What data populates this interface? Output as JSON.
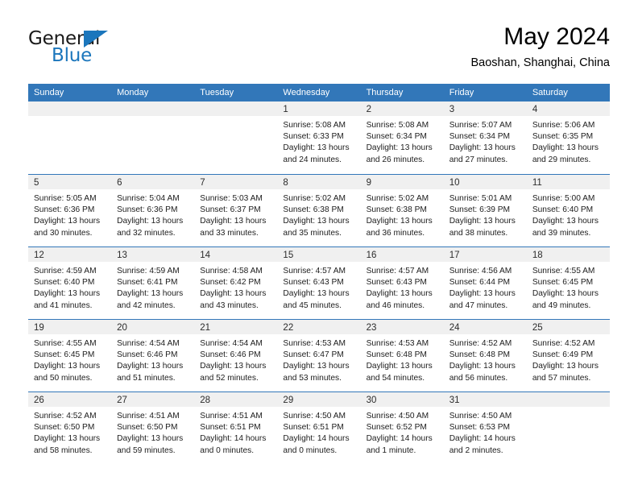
{
  "brand": {
    "name_top": "General",
    "name_bottom": "Blue",
    "color_black": "#1a1a1a",
    "color_blue": "#1b76bc"
  },
  "header": {
    "title": "May 2024",
    "subtitle": "Baoshan, Shanghai, China"
  },
  "theme": {
    "header_bar": "#3277b9",
    "date_band": "#f0f0f0",
    "text": "#1c1c1c"
  },
  "calendar": {
    "day_headers": [
      "Sunday",
      "Monday",
      "Tuesday",
      "Wednesday",
      "Thursday",
      "Friday",
      "Saturday"
    ],
    "weeks": [
      [
        {
          "date": "",
          "lines": []
        },
        {
          "date": "",
          "lines": []
        },
        {
          "date": "",
          "lines": []
        },
        {
          "date": "1",
          "lines": [
            "Sunrise: 5:08 AM",
            "Sunset: 6:33 PM",
            "Daylight: 13 hours",
            "and 24 minutes."
          ]
        },
        {
          "date": "2",
          "lines": [
            "Sunrise: 5:08 AM",
            "Sunset: 6:34 PM",
            "Daylight: 13 hours",
            "and 26 minutes."
          ]
        },
        {
          "date": "3",
          "lines": [
            "Sunrise: 5:07 AM",
            "Sunset: 6:34 PM",
            "Daylight: 13 hours",
            "and 27 minutes."
          ]
        },
        {
          "date": "4",
          "lines": [
            "Sunrise: 5:06 AM",
            "Sunset: 6:35 PM",
            "Daylight: 13 hours",
            "and 29 minutes."
          ]
        }
      ],
      [
        {
          "date": "5",
          "lines": [
            "Sunrise: 5:05 AM",
            "Sunset: 6:36 PM",
            "Daylight: 13 hours",
            "and 30 minutes."
          ]
        },
        {
          "date": "6",
          "lines": [
            "Sunrise: 5:04 AM",
            "Sunset: 6:36 PM",
            "Daylight: 13 hours",
            "and 32 minutes."
          ]
        },
        {
          "date": "7",
          "lines": [
            "Sunrise: 5:03 AM",
            "Sunset: 6:37 PM",
            "Daylight: 13 hours",
            "and 33 minutes."
          ]
        },
        {
          "date": "8",
          "lines": [
            "Sunrise: 5:02 AM",
            "Sunset: 6:38 PM",
            "Daylight: 13 hours",
            "and 35 minutes."
          ]
        },
        {
          "date": "9",
          "lines": [
            "Sunrise: 5:02 AM",
            "Sunset: 6:38 PM",
            "Daylight: 13 hours",
            "and 36 minutes."
          ]
        },
        {
          "date": "10",
          "lines": [
            "Sunrise: 5:01 AM",
            "Sunset: 6:39 PM",
            "Daylight: 13 hours",
            "and 38 minutes."
          ]
        },
        {
          "date": "11",
          "lines": [
            "Sunrise: 5:00 AM",
            "Sunset: 6:40 PM",
            "Daylight: 13 hours",
            "and 39 minutes."
          ]
        }
      ],
      [
        {
          "date": "12",
          "lines": [
            "Sunrise: 4:59 AM",
            "Sunset: 6:40 PM",
            "Daylight: 13 hours",
            "and 41 minutes."
          ]
        },
        {
          "date": "13",
          "lines": [
            "Sunrise: 4:59 AM",
            "Sunset: 6:41 PM",
            "Daylight: 13 hours",
            "and 42 minutes."
          ]
        },
        {
          "date": "14",
          "lines": [
            "Sunrise: 4:58 AM",
            "Sunset: 6:42 PM",
            "Daylight: 13 hours",
            "and 43 minutes."
          ]
        },
        {
          "date": "15",
          "lines": [
            "Sunrise: 4:57 AM",
            "Sunset: 6:43 PM",
            "Daylight: 13 hours",
            "and 45 minutes."
          ]
        },
        {
          "date": "16",
          "lines": [
            "Sunrise: 4:57 AM",
            "Sunset: 6:43 PM",
            "Daylight: 13 hours",
            "and 46 minutes."
          ]
        },
        {
          "date": "17",
          "lines": [
            "Sunrise: 4:56 AM",
            "Sunset: 6:44 PM",
            "Daylight: 13 hours",
            "and 47 minutes."
          ]
        },
        {
          "date": "18",
          "lines": [
            "Sunrise: 4:55 AM",
            "Sunset: 6:45 PM",
            "Daylight: 13 hours",
            "and 49 minutes."
          ]
        }
      ],
      [
        {
          "date": "19",
          "lines": [
            "Sunrise: 4:55 AM",
            "Sunset: 6:45 PM",
            "Daylight: 13 hours",
            "and 50 minutes."
          ]
        },
        {
          "date": "20",
          "lines": [
            "Sunrise: 4:54 AM",
            "Sunset: 6:46 PM",
            "Daylight: 13 hours",
            "and 51 minutes."
          ]
        },
        {
          "date": "21",
          "lines": [
            "Sunrise: 4:54 AM",
            "Sunset: 6:46 PM",
            "Daylight: 13 hours",
            "and 52 minutes."
          ]
        },
        {
          "date": "22",
          "lines": [
            "Sunrise: 4:53 AM",
            "Sunset: 6:47 PM",
            "Daylight: 13 hours",
            "and 53 minutes."
          ]
        },
        {
          "date": "23",
          "lines": [
            "Sunrise: 4:53 AM",
            "Sunset: 6:48 PM",
            "Daylight: 13 hours",
            "and 54 minutes."
          ]
        },
        {
          "date": "24",
          "lines": [
            "Sunrise: 4:52 AM",
            "Sunset: 6:48 PM",
            "Daylight: 13 hours",
            "and 56 minutes."
          ]
        },
        {
          "date": "25",
          "lines": [
            "Sunrise: 4:52 AM",
            "Sunset: 6:49 PM",
            "Daylight: 13 hours",
            "and 57 minutes."
          ]
        }
      ],
      [
        {
          "date": "26",
          "lines": [
            "Sunrise: 4:52 AM",
            "Sunset: 6:50 PM",
            "Daylight: 13 hours",
            "and 58 minutes."
          ]
        },
        {
          "date": "27",
          "lines": [
            "Sunrise: 4:51 AM",
            "Sunset: 6:50 PM",
            "Daylight: 13 hours",
            "and 59 minutes."
          ]
        },
        {
          "date": "28",
          "lines": [
            "Sunrise: 4:51 AM",
            "Sunset: 6:51 PM",
            "Daylight: 14 hours",
            "and 0 minutes."
          ]
        },
        {
          "date": "29",
          "lines": [
            "Sunrise: 4:50 AM",
            "Sunset: 6:51 PM",
            "Daylight: 14 hours",
            "and 0 minutes."
          ]
        },
        {
          "date": "30",
          "lines": [
            "Sunrise: 4:50 AM",
            "Sunset: 6:52 PM",
            "Daylight: 14 hours",
            "and 1 minute."
          ]
        },
        {
          "date": "31",
          "lines": [
            "Sunrise: 4:50 AM",
            "Sunset: 6:53 PM",
            "Daylight: 14 hours",
            "and 2 minutes."
          ]
        },
        {
          "date": "",
          "lines": []
        }
      ]
    ]
  }
}
